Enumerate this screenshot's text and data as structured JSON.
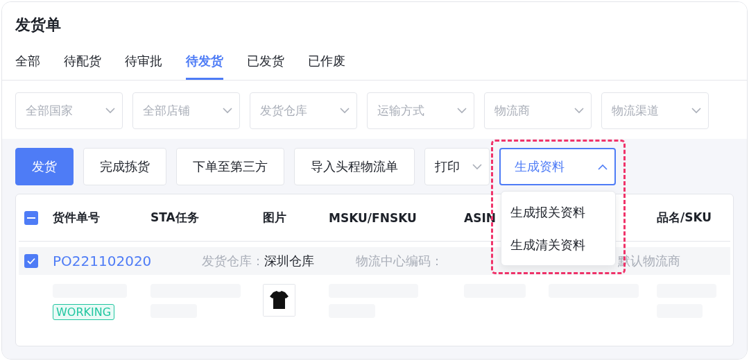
{
  "title": "发货单",
  "tabs": [
    {
      "label": "全部",
      "selected": false
    },
    {
      "label": "待配货",
      "selected": false
    },
    {
      "label": "待审批",
      "selected": false
    },
    {
      "label": "待发货",
      "selected": true
    },
    {
      "label": "已发货",
      "selected": false
    },
    {
      "label": "已作废",
      "selected": false
    }
  ],
  "filters": [
    {
      "placeholder": "全部国家"
    },
    {
      "placeholder": "全部店铺"
    },
    {
      "placeholder": "发货仓库"
    },
    {
      "placeholder": "运输方式"
    },
    {
      "placeholder": "物流商"
    },
    {
      "placeholder": "物流渠道"
    }
  ],
  "actions": [
    {
      "kind": "primary",
      "label": "发货"
    },
    {
      "kind": "plain",
      "label": "完成拣货"
    },
    {
      "kind": "plain",
      "label": "下单至第三方"
    },
    {
      "kind": "plain",
      "label": "导入头程物流单"
    },
    {
      "kind": "menu",
      "label": "打印",
      "expanded": false
    },
    {
      "kind": "menu",
      "label": "生成资料",
      "expanded": true,
      "menu": [
        "生成报关资料",
        "生成清关资料"
      ]
    }
  ],
  "table": {
    "select_all": {
      "indeterminate": true
    },
    "columns": [
      "货件单号",
      "STA任务",
      "图片",
      "MSKU/FNSKU",
      "ASIN",
      "",
      "品名/SKU"
    ],
    "shipment": {
      "checked": true,
      "number": "PO221102020",
      "warehouse_label": "发货仓库：",
      "warehouse": "深圳仓库",
      "center_label": "物流中心编码：",
      "carrier": "默认物流商"
    },
    "item": {
      "status": "WORKING"
    }
  }
}
